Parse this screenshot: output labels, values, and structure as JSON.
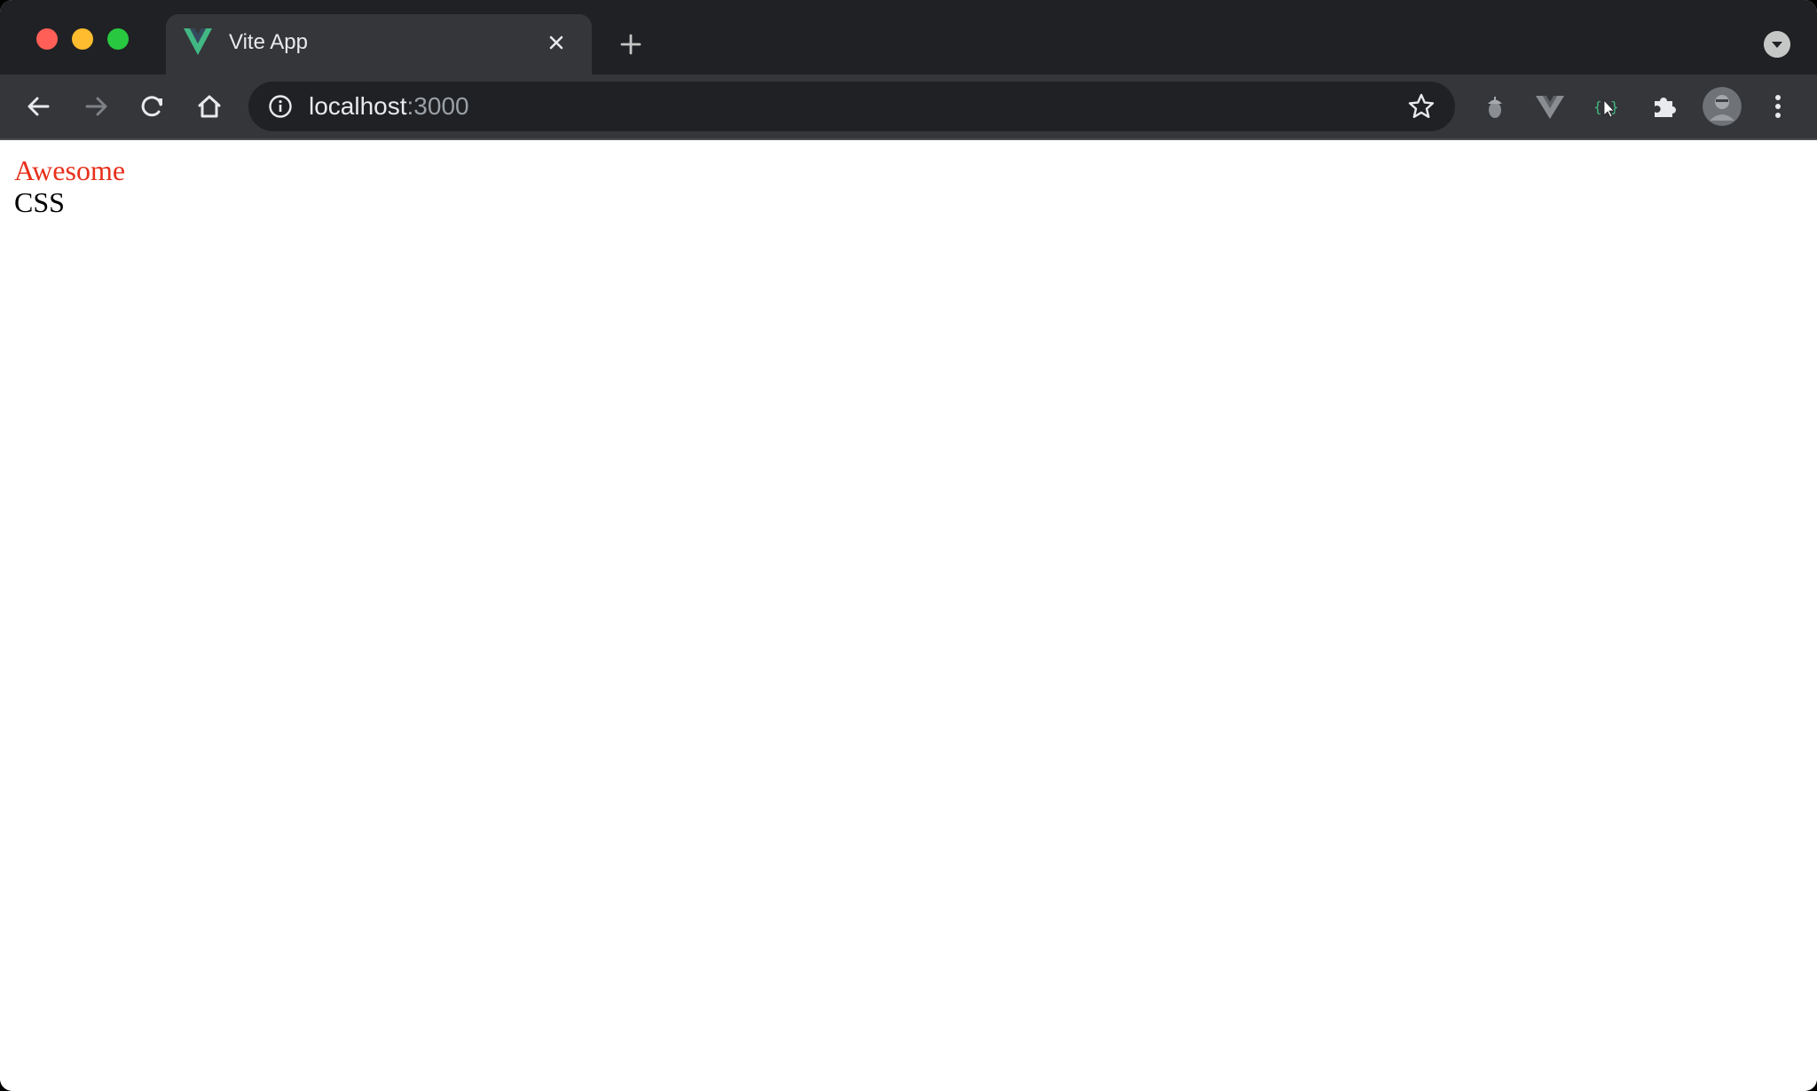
{
  "browser": {
    "tab": {
      "title": "Vite App",
      "favicon": "vite-v-icon"
    },
    "address_bar": {
      "host": "localhost",
      "port": ":3000"
    },
    "icons": {
      "back": "arrow-left-icon",
      "forward": "arrow-right-icon",
      "reload": "reload-icon",
      "home": "home-icon",
      "site_info": "info-icon",
      "bookmark": "star-icon",
      "new_tab": "plus-icon",
      "close_tab": "close-icon",
      "tab_search": "chevron-down-icon",
      "extensions": "puzzle-icon",
      "menu": "kebab-menu-icon"
    },
    "colors": {
      "frame": "#202124",
      "toolbar": "#35363a",
      "omnibox": "#202124",
      "vite_green": "#41b883"
    }
  },
  "page": {
    "lines": [
      {
        "text": "Awesome",
        "color": "#e8301c"
      },
      {
        "text": "CSS",
        "color": "#000000"
      }
    ]
  }
}
